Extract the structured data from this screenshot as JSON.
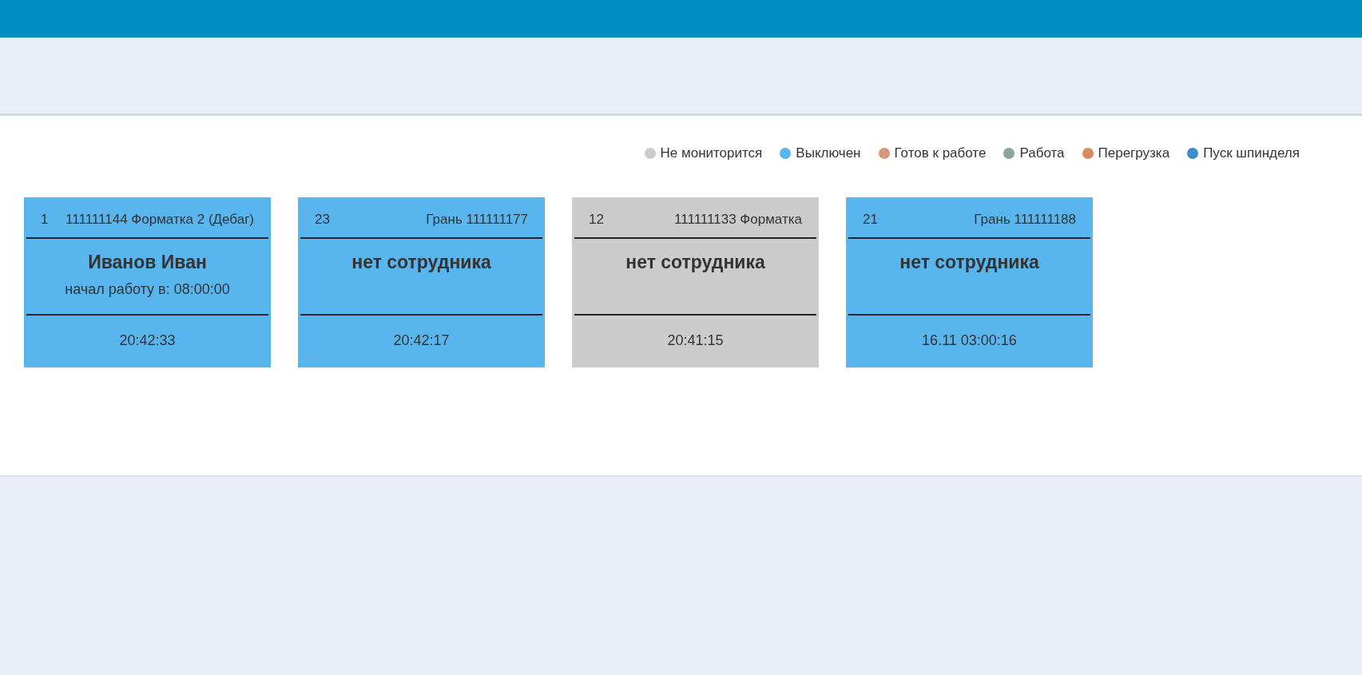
{
  "legend": [
    {
      "label": "Не мониторится",
      "color": "#cccccc"
    },
    {
      "label": "Выключен",
      "color": "#58b5ee"
    },
    {
      "label": "Готов к работе",
      "color": "#d9967a"
    },
    {
      "label": "Работа",
      "color": "#8fa3a0"
    },
    {
      "label": "Перегрузка",
      "color": "#dc8a64"
    },
    {
      "label": "Пуск шпинделя",
      "color": "#3d8fcc"
    }
  ],
  "machines": [
    {
      "number": "1",
      "name": "111111144 Форматка 2 (Дебаг)",
      "employee": "Иванов Иван",
      "started": "начал работу в: 08:00:00",
      "time": "20:42:33",
      "color": "#58b5ee"
    },
    {
      "number": "23",
      "name": "Грань 111111177",
      "employee": "нет сотрудника",
      "time": "20:42:17",
      "color": "#58b5ee"
    },
    {
      "number": "12",
      "name": "111111133 Форматка",
      "employee": "нет сотрудника",
      "time": "20:41:15",
      "color": "#cccccc"
    },
    {
      "number": "21",
      "name": "Грань 111111188",
      "employee": "нет сотрудника",
      "time": "16.11 03:00:16",
      "color": "#58b5ee"
    }
  ]
}
